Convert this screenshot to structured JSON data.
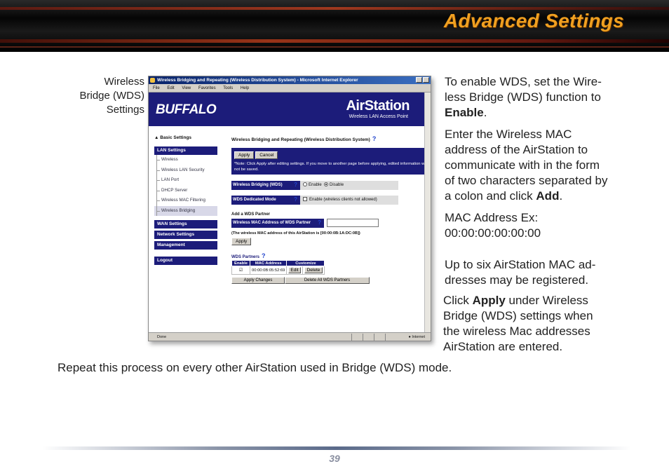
{
  "header": {
    "title": "Advanced Settings"
  },
  "caption": [
    "Wireless",
    "Bridge (WDS)",
    "Settings"
  ],
  "screenshot": {
    "window_title": "Wireless Bridging and Repeating (Wireless Distribution System) - Microsoft Internet Explorer",
    "menu": [
      "File",
      "Edit",
      "View",
      "Favorites",
      "Tools",
      "Help"
    ],
    "brand": "BUFFALO",
    "product": "AirStation",
    "product_sub": "Wireless LAN Access Point",
    "nav": {
      "basic": "Basic Settings",
      "lan": "LAN Settings",
      "lan_items": [
        "Wireless",
        "Wireless LAN Security",
        "LAN Port",
        "DHCP Server",
        "Wireless MAC Filtering",
        "Wireless Bridging"
      ],
      "wan": "WAN Settings",
      "network": "Network Settings",
      "management": "Management",
      "logout": "Logout"
    },
    "section_title": "Wireless Bridging and Repeating (Wireless Distribution System)",
    "help_mark": "?",
    "apply": "Apply",
    "cancel": "Cancel",
    "note": "*Note: Click Apply after editing settings. If you move to another page before applying, edited information will not be saved.",
    "wds_label": "Wireless Bridging (WDS)",
    "enable": "Enable",
    "disable": "Disable",
    "dedicated_label": "WDS Dedicated Mode",
    "dedicated_value": "Enable (wireless clients not allowed)",
    "add_partner": "Add a WDS Partner",
    "mac_label": "Wireless MAC Address of WDS Partner",
    "own_mac_note": "(The wireless MAC address of this AirStation is [00:00:0B:1A:DC:0B])",
    "partners_title": "WDS Partners",
    "table_headers": [
      "Enable",
      "MAC Address",
      "Customize"
    ],
    "partner_mac": "00:00:0B:05:52:69",
    "edit": "Edit",
    "delete": "Delete",
    "apply_changes": "Apply Changes",
    "delete_all": "Delete All WDS Partners",
    "status_left": "Done",
    "status_zone": "Internet"
  },
  "right": {
    "p1_a": "To enable WDS, set the Wire-",
    "p1_b": "less Bridge (WDS) function to",
    "p1_c": "Enable",
    "p1_d": ".",
    "p2_a": "Enter the Wireless MAC",
    "p2_b": "address of the AirStation to",
    "p2_c": "communicate with in the form",
    "p2_d": "of two characters separated by",
    "p2_e": "a colon and click ",
    "p2_f": "Add",
    "p2_g": ".",
    "p3_a": "MAC Address Ex:",
    "p3_b": "00:00:00:00:00:00",
    "p4_a": "Up to six AirStation MAC ad-",
    "p4_b": "dresses may be registered.",
    "p5_a": "Click ",
    "p5_b": "Apply",
    "p5_c": " under Wireless",
    "p5_d": "Bridge (WDS) settings when",
    "p5_e": "the wireless Mac addresses",
    "p5_f": "AirStation are entered."
  },
  "bottom_text": "Repeat this process on every other AirStation used in Bridge (WDS) mode.",
  "page_number": "39"
}
